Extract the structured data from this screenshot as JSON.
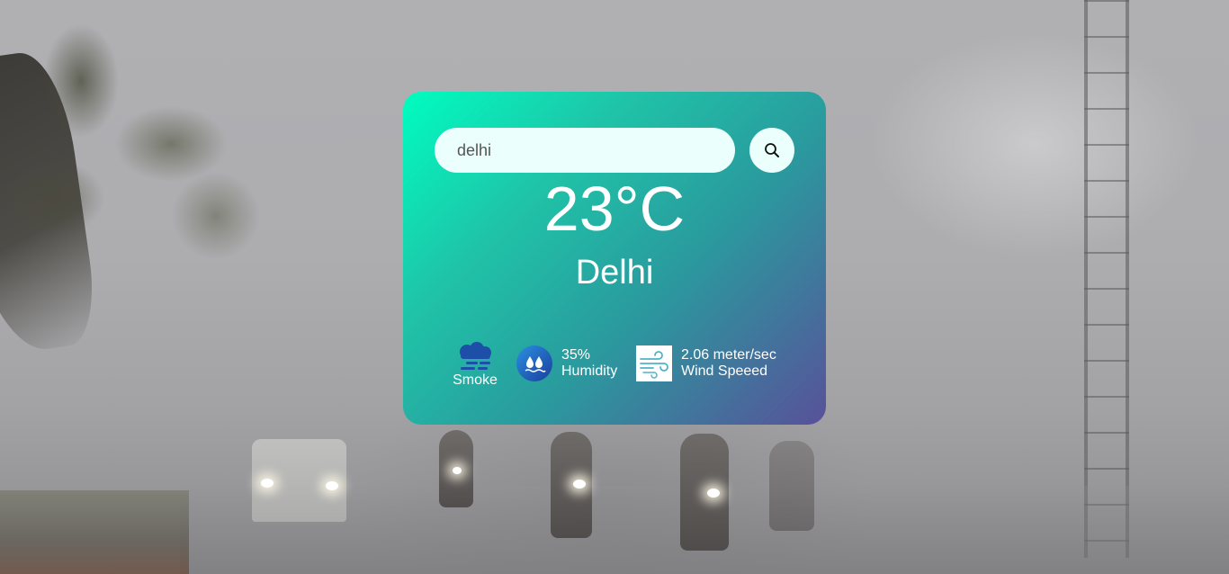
{
  "search": {
    "value": "delhi"
  },
  "weather": {
    "temperature": "23°C",
    "city": "Delhi",
    "condition": "Smoke",
    "humidity_value": "35%",
    "humidity_label": "Humidity",
    "wind_value": "2.06 meter/sec",
    "wind_label": "Wind Speeed"
  },
  "icons": {
    "search": "search-icon",
    "condition": "smoke-icon",
    "humidity": "humidity-icon",
    "wind": "wind-icon"
  },
  "colors": {
    "card_gradient_start": "#00fdc0",
    "card_gradient_end": "#58519a",
    "field_background": "#ebfffc",
    "text": "#ffffff"
  }
}
